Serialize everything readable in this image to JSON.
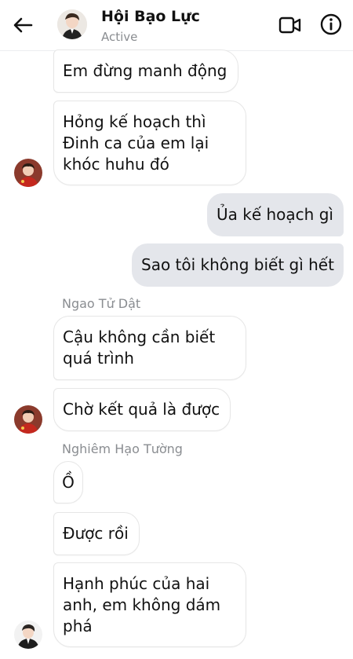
{
  "header": {
    "title": "Hội Bạo Lực",
    "status": "Active"
  },
  "messages": [
    {
      "text": "Em đừng manh động",
      "direction": "incoming"
    },
    {
      "text": "Hỏng kế hoạch thì\nĐinh ca của em lại\nkhóc huhu đó",
      "direction": "incoming"
    },
    {
      "text": "Ủa kế hoạch gì",
      "direction": "outgoing"
    },
    {
      "text": "Sao tôi không biết gì hết",
      "direction": "outgoing"
    },
    {
      "text": "Cậu không cần biết\nquá trình",
      "direction": "incoming",
      "sender": "Ngao Tử Dật"
    },
    {
      "text": "Chờ kết quả là được",
      "direction": "incoming"
    },
    {
      "text": "Ồ",
      "direction": "incoming",
      "sender": "Nghiêm Hạo Tường"
    },
    {
      "text": "Được rồi",
      "direction": "incoming"
    },
    {
      "text": "Hạnh phúc của hai\nanh, em không dám\nphá",
      "direction": "incoming"
    }
  ],
  "icons": {
    "back": "arrow-left",
    "video": "video-camera",
    "info": "info-circle"
  },
  "colors": {
    "outgoing_bubble": "#e4e6eb",
    "incoming_border": "#e6e6e6",
    "meta_text": "#8a8d91"
  }
}
